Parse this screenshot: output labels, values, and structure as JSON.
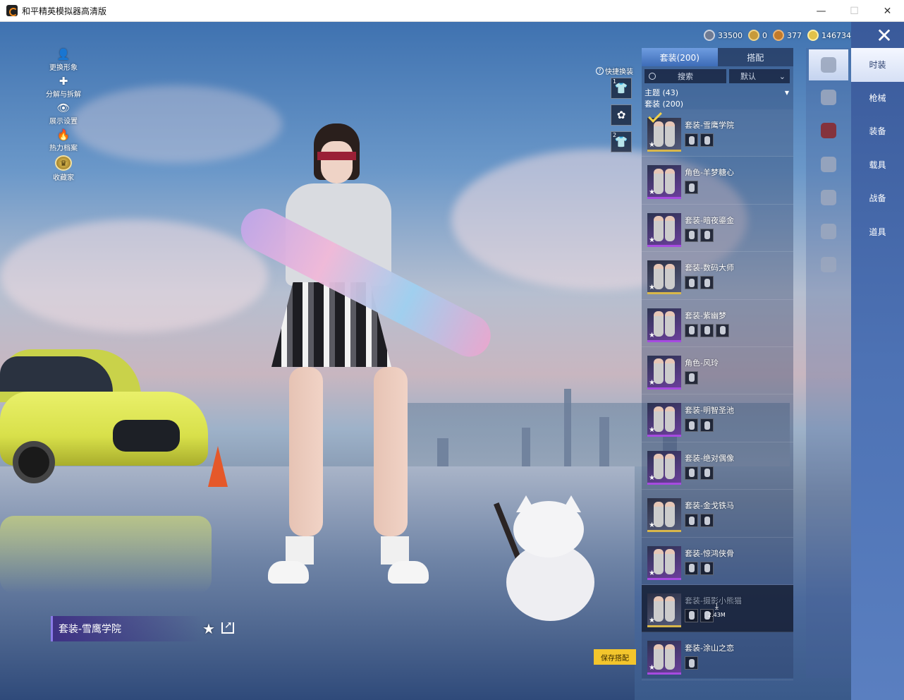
{
  "window": {
    "title": "和平精英模拟器高清版",
    "minimize": "—",
    "maximize": "☐",
    "close": "✕"
  },
  "left_menu": [
    {
      "label": "更换形象",
      "icon": "👤"
    },
    {
      "label": "分解与拆解",
      "icon": "✚"
    },
    {
      "label": "展示设置",
      "icon": "👁"
    },
    {
      "label": "热力档案",
      "icon": "🔥"
    },
    {
      "label": "收藏家",
      "icon": "♛"
    }
  ],
  "currency": [
    {
      "value": "33500",
      "color": "#6f7b93"
    },
    {
      "value": "0",
      "color": "#c79a3a"
    },
    {
      "value": "377",
      "color": "#c27a2a"
    },
    {
      "value": "146734",
      "color": "#e2c24a"
    }
  ],
  "quick_change": {
    "label": "快捷换装",
    "help_icon": "?",
    "slots": [
      {
        "number": "1",
        "icon": "👕"
      },
      {
        "number": "",
        "icon": "✿"
      },
      {
        "number": "2",
        "icon": "👕"
      }
    ]
  },
  "outfit_panel": {
    "tabs": [
      "套装(200)",
      "搭配"
    ],
    "search_label": "搜索",
    "sort_label": "默认",
    "filter_label": "主题 (43)",
    "section_label": "套装 (200)",
    "items": [
      {
        "name": "套装-雪鹰学院",
        "subitems": 2,
        "selected": true
      },
      {
        "name": "角色-羊梦糖心",
        "subitems": 1
      },
      {
        "name": "套装-暗夜鎏金",
        "subitems": 2
      },
      {
        "name": "套装-数码大师",
        "subitems": 2
      },
      {
        "name": "套装-紫幽梦",
        "subitems": 3
      },
      {
        "name": "角色-风玲",
        "subitems": 1
      },
      {
        "name": "套装-明智圣池",
        "subitems": 2
      },
      {
        "name": "套装-绝对偶像",
        "subitems": 2
      },
      {
        "name": "套装-金戈铁马",
        "subitems": 2
      },
      {
        "name": "套装-惊鸿侠骨",
        "subitems": 2
      },
      {
        "name": "套装-摄影小熊猫",
        "subitems": 2,
        "locked": true
      },
      {
        "name": "套装-涂山之恋",
        "subitems": 1
      }
    ],
    "download_size": "2.43M"
  },
  "category_icons": [
    "outfit-icon",
    "hat-icon",
    "mask-icon",
    "face-icon",
    "top-icon",
    "pants-icon",
    "shoes-icon"
  ],
  "right_tabs": [
    "时装",
    "枪械",
    "装备",
    "载具",
    "战备",
    "道具"
  ],
  "close_button": "✕",
  "current_outfit": "套装-雪鹰学院",
  "favorite_icon": "★",
  "save_button": "保存搭配"
}
